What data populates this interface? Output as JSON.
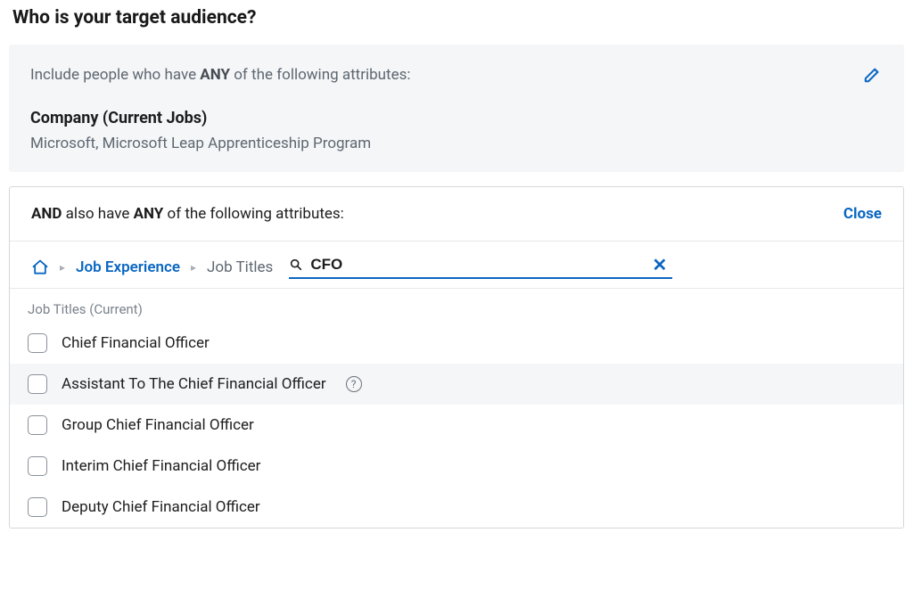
{
  "page": {
    "title": "Who is your target audience?"
  },
  "includePanel": {
    "prefix": "Include people who have ",
    "emph": "ANY",
    "suffix": " of the following attributes:",
    "attribute": {
      "title": "Company (Current Jobs)",
      "values": "Microsoft, Microsoft Leap Apprenticeship Program"
    }
  },
  "andPanel": {
    "prefix": "AND",
    "middle1": " also have ",
    "emph": "ANY",
    "suffix": " of the following attributes:",
    "closeLabel": "Close",
    "breadcrumb": {
      "link": "Job Experience",
      "current": "Job Titles"
    },
    "search": {
      "value": "CFO"
    },
    "resultsLabel": "Job Titles (Current)",
    "results": [
      {
        "label": "Chief Financial Officer",
        "highlight": false,
        "help": false
      },
      {
        "label": "Assistant To The Chief Financial Officer",
        "highlight": true,
        "help": true
      },
      {
        "label": "Group Chief Financial Officer",
        "highlight": false,
        "help": false
      },
      {
        "label": "Interim Chief Financial Officer",
        "highlight": false,
        "help": false
      },
      {
        "label": "Deputy Chief Financial Officer",
        "highlight": false,
        "help": false
      }
    ]
  }
}
